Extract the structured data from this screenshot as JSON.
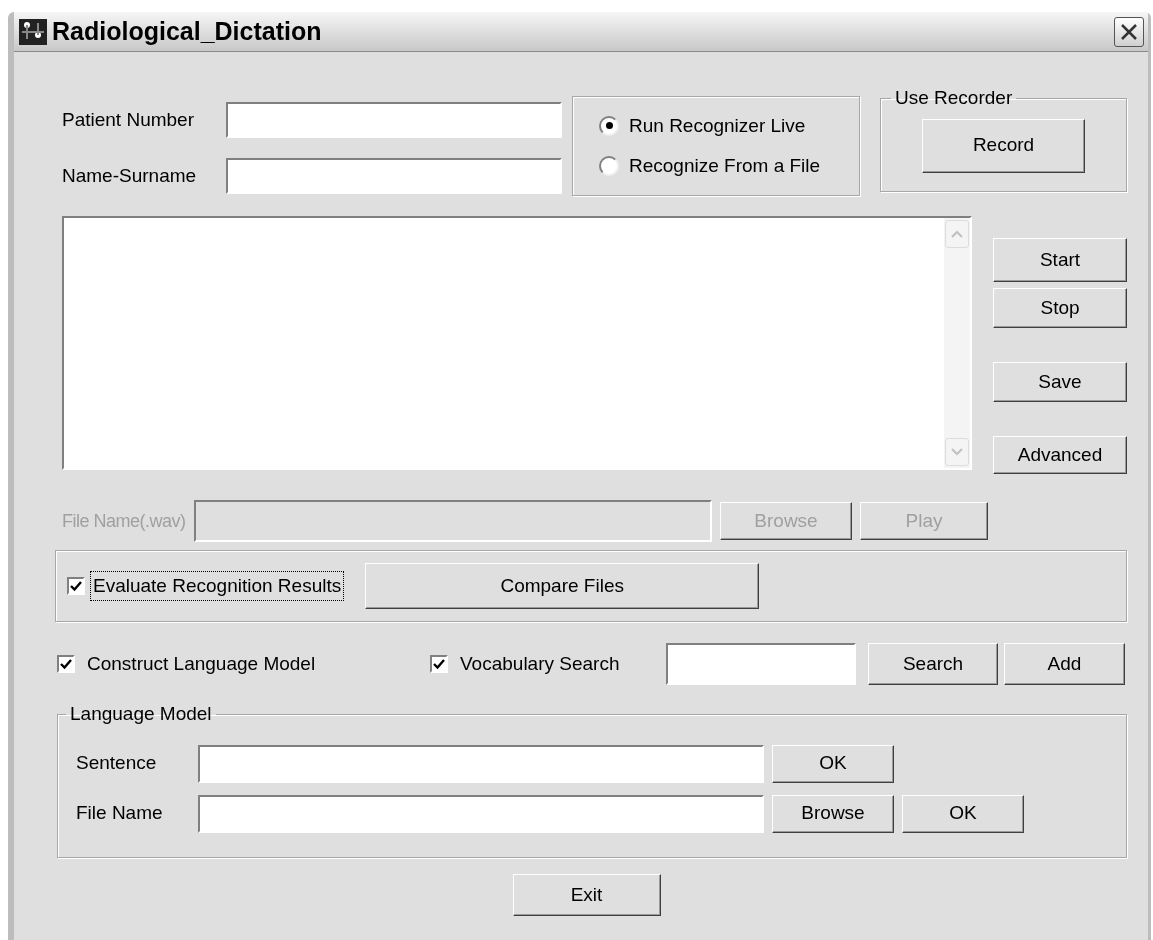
{
  "window": {
    "title": "Radiological_Dictation"
  },
  "patient_fields": [
    {
      "label": "Patient Number"
    },
    {
      "label": "Name-Surname"
    }
  ],
  "recognition_mode": [
    {
      "label": "Run Recognizer Live",
      "selected": true
    },
    {
      "label": "Recognize From a File",
      "selected": false
    }
  ],
  "recorder_group": {
    "title": "Use Recorder",
    "button": "Record"
  },
  "side_buttons": [
    "Start",
    "Stop",
    "Save",
    "Advanced"
  ],
  "wav_file": {
    "label": "File Name(.wav)",
    "disabled": true,
    "buttons": [
      "Browse",
      "Play"
    ]
  },
  "evaluation": {
    "label": "Evaluate Recognition Results",
    "checked": true,
    "focused": true,
    "button": "Compare Files"
  },
  "options": [
    {
      "label": "Construct Language Model",
      "checked": true
    },
    {
      "label": "Vocabulary Search",
      "checked": true
    }
  ],
  "vocabulary_buttons": [
    "Search",
    "Add"
  ],
  "language_model": {
    "title": "Language Model",
    "rows": [
      {
        "label": "Sentence",
        "buttons": [
          "OK"
        ]
      },
      {
        "label": "File Name",
        "buttons": [
          "Browse",
          "OK"
        ]
      }
    ]
  },
  "exit_button": "Exit"
}
